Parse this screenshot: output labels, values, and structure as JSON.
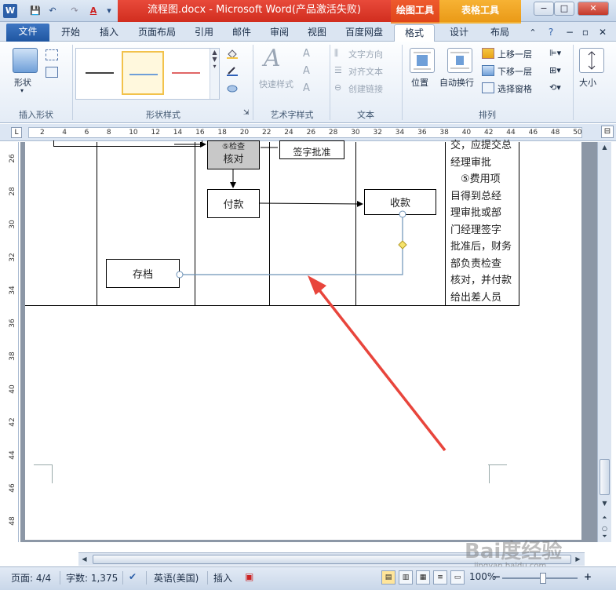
{
  "window": {
    "title": "流程图.docx - Microsoft Word(产品激活失败)",
    "contextual_tab_drawing": "绘图工具",
    "contextual_tab_table": "表格工具",
    "minimize_glyph": "−",
    "maximize_glyph": "□",
    "close_glyph": "✕"
  },
  "quick_access": {
    "app_icon": "W",
    "save_glyph": "💾",
    "undo_glyph": "↶",
    "redo_glyph": "↷",
    "font_color_glyph": "A",
    "customize_glyph": "▾"
  },
  "tabs": {
    "file": "文件",
    "home": "开始",
    "insert": "插入",
    "page_layout": "页面布局",
    "references": "引用",
    "mailings": "邮件",
    "review": "审阅",
    "view": "视图",
    "baidu": "百度网盘",
    "format": "格式",
    "design": "设计",
    "layout": "布局"
  },
  "ribbon": {
    "insert_shapes": {
      "shapes_label": "形状",
      "group_label": "插入形状"
    },
    "shape_styles": {
      "group_label": "形状样式",
      "style_colors": [
        "#404040",
        "#6f9fd8",
        "#e06666"
      ]
    },
    "wordart_styles": {
      "quick_styles_label": "快速样式",
      "group_label": "艺术字样式"
    },
    "text": {
      "text_direction": "文字方向",
      "align_text": "对齐文本",
      "create_link": "创建链接",
      "group_label": "文本"
    },
    "arrange": {
      "position": "位置",
      "wrap_text": "自动换行",
      "bring_forward": "上移一层",
      "send_backward": "下移一层",
      "selection_pane": "选择窗格",
      "group_label": "排列"
    },
    "size": {
      "size_label": "大小"
    }
  },
  "ruler": {
    "corner": "L",
    "h_numbers": [
      "2",
      "4",
      "6",
      "8",
      "10",
      "12",
      "14",
      "16",
      "18",
      "20",
      "22",
      "24",
      "26",
      "28",
      "30",
      "32",
      "34",
      "36",
      "38",
      "40",
      "42",
      "44",
      "46",
      "48",
      "50"
    ],
    "v_numbers": [
      "26",
      "28",
      "30",
      "32",
      "34",
      "36",
      "38",
      "40",
      "42",
      "44",
      "46",
      "48"
    ]
  },
  "document": {
    "box_check_top": "⑤检查",
    "box_check": "核对",
    "box_sign_approve": "签字批准",
    "box_pay": "付款",
    "box_receive": "收款",
    "box_archive": "存档",
    "note_lines": [
      "交，应提交总",
      "经理审批",
      "　⑤费用项",
      "目得到总经",
      "理审批或部",
      "门经理签字",
      "批准后，财务",
      "部负责检查",
      "核对，并付款",
      "给出差人员"
    ]
  },
  "status": {
    "page": "页面: 4/4",
    "words": "字数: 1,375",
    "language": "英语(美国)",
    "insert_mode": "插入",
    "zoom": "100%",
    "zoom_minus": "−",
    "zoom_plus": "+"
  },
  "watermark": {
    "main": "Bai度经验",
    "sub": "jingyan.baidu.com"
  },
  "colors": {
    "title_red": "#d12d1f",
    "drawing_tools_orange": "#e0451a",
    "table_tools_yellow": "#ea9a17",
    "file_tab_blue": "#1f56a1",
    "connector_blue": "#6d93b8",
    "arrow_red": "#e8453c",
    "handle_yellow": "#f6e36b"
  }
}
